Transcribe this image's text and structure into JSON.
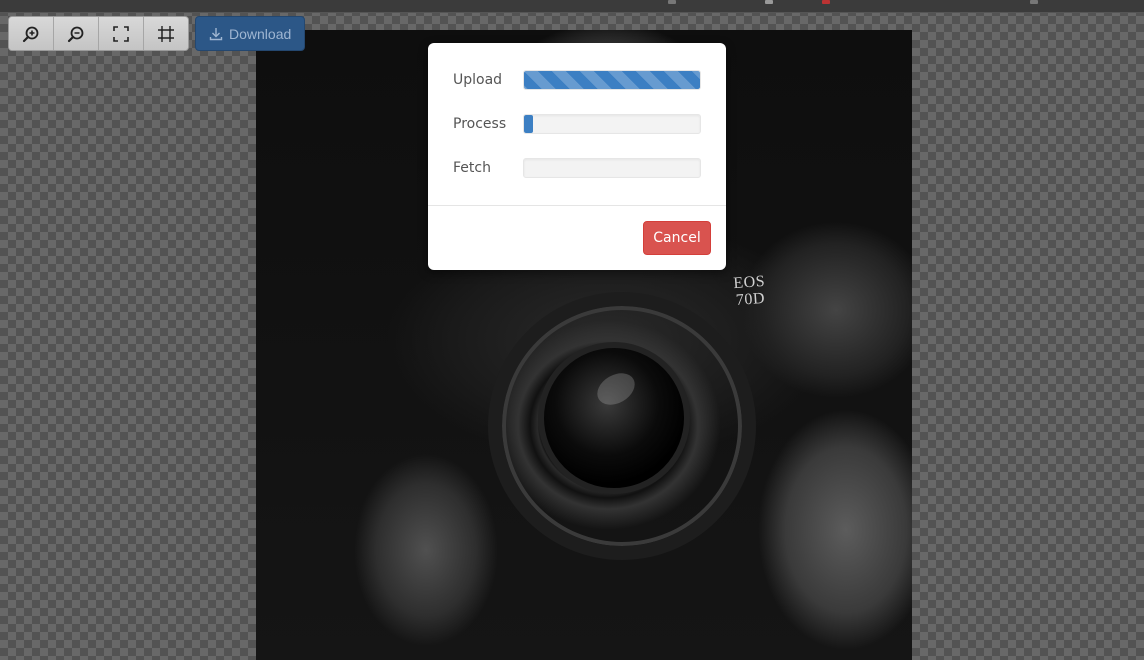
{
  "toolbar": {
    "buttons": [
      {
        "icon": "zoom-in-icon"
      },
      {
        "icon": "zoom-out-icon"
      },
      {
        "icon": "fit-screen-icon"
      },
      {
        "icon": "actual-size-icon"
      }
    ],
    "download_label": "Download",
    "download_icon": "download-icon"
  },
  "photo": {
    "camera_model": "EOS",
    "camera_model_number": "70D"
  },
  "modal": {
    "progress": [
      {
        "label": "Upload",
        "value": 1.0,
        "striped": true
      },
      {
        "label": "Process",
        "value": 0.05,
        "striped": false
      },
      {
        "label": "Fetch",
        "value": 0.0,
        "striped": false
      }
    ],
    "cancel_label": "Cancel"
  },
  "colors": {
    "progress_fill": "#3c7fc3",
    "cancel_button": "#d9534f",
    "download_button": "#2c5787"
  }
}
